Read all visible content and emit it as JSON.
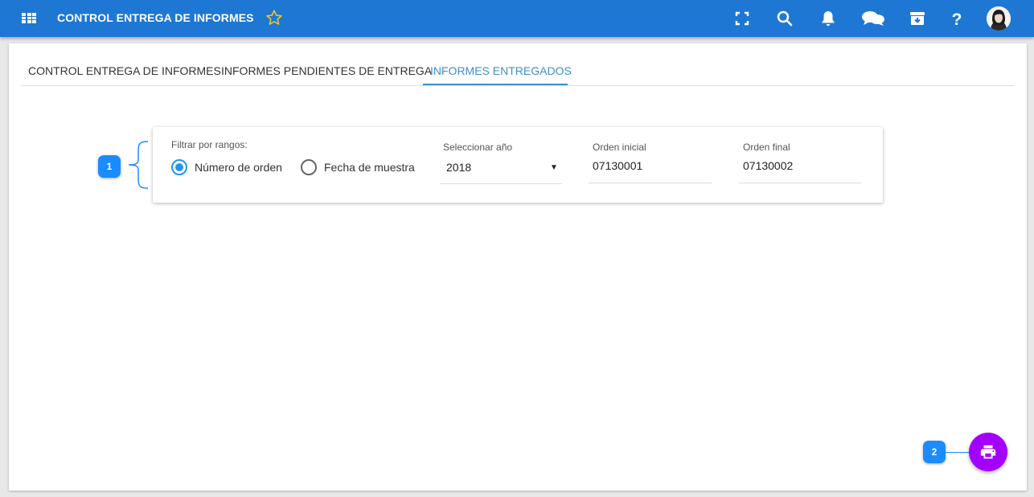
{
  "header": {
    "title": "CONTROL ENTREGA DE INFORMES",
    "icons": [
      "apps-grid-icon",
      "star-icon",
      "fullscreen-icon",
      "search-icon",
      "bell-icon",
      "chat-icon",
      "archive-icon",
      "help-icon",
      "avatar"
    ],
    "brand_color": "#1e77d3",
    "star_color": "#f0c419"
  },
  "tabs": [
    {
      "label": "CONTROL ENTREGA DE INFORMES",
      "active": false
    },
    {
      "label": "INFORMES PENDIENTES DE ENTREGA",
      "active": false
    },
    {
      "label": "INFORMES ENTREGADOS",
      "active": true
    }
  ],
  "filter": {
    "label": "Filtrar por rangos:",
    "options": [
      {
        "label": "Número de orden",
        "checked": true
      },
      {
        "label": "Fecha de muestra",
        "checked": false
      }
    ],
    "year": {
      "label": "Seleccionar año",
      "value": "2018"
    },
    "order_start": {
      "label": "Orden inicial",
      "value": "07130001"
    },
    "order_end": {
      "label": "Orden final",
      "value": "07130002"
    }
  },
  "annotations": {
    "badge1": "1",
    "badge2": "2",
    "color": "#1a8cff"
  },
  "fab": {
    "icon": "print-icon",
    "color": "#a500ff"
  }
}
